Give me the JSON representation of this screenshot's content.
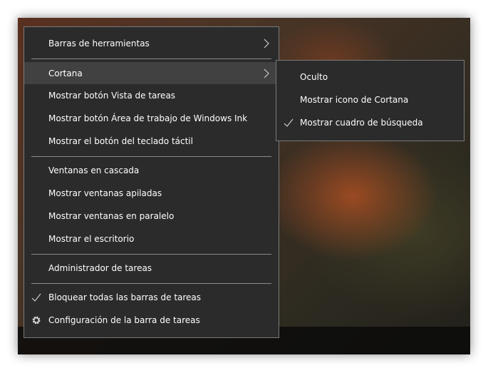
{
  "main_menu": {
    "items": [
      {
        "label": "Barras de herramientas",
        "submenu": true
      },
      {
        "label": "Cortana",
        "submenu": true,
        "highlighted": true
      },
      {
        "label": "Mostrar botón Vista de tareas"
      },
      {
        "label": "Mostrar botón Área de trabajo de Windows Ink"
      },
      {
        "label": "Mostrar el botón del teclado táctil"
      },
      {
        "label": "Ventanas en cascada"
      },
      {
        "label": "Mostrar ventanas apiladas"
      },
      {
        "label": "Mostrar ventanas en paralelo"
      },
      {
        "label": "Mostrar el escritorio"
      },
      {
        "label": "Administrador de tareas"
      },
      {
        "label": "Bloquear todas las barras de tareas",
        "checked": true
      },
      {
        "label": "Configuración de la barra de tareas",
        "icon": "gear-icon"
      }
    ]
  },
  "cortana_submenu": {
    "items": [
      {
        "label": "Oculto"
      },
      {
        "label": "Mostrar icono de Cortana"
      },
      {
        "label": "Mostrar cuadro de búsqueda",
        "checked": true
      }
    ]
  },
  "colors": {
    "menu_bg": "#2b2b2b",
    "highlight": "#414141",
    "border": "#7a7a7a"
  }
}
